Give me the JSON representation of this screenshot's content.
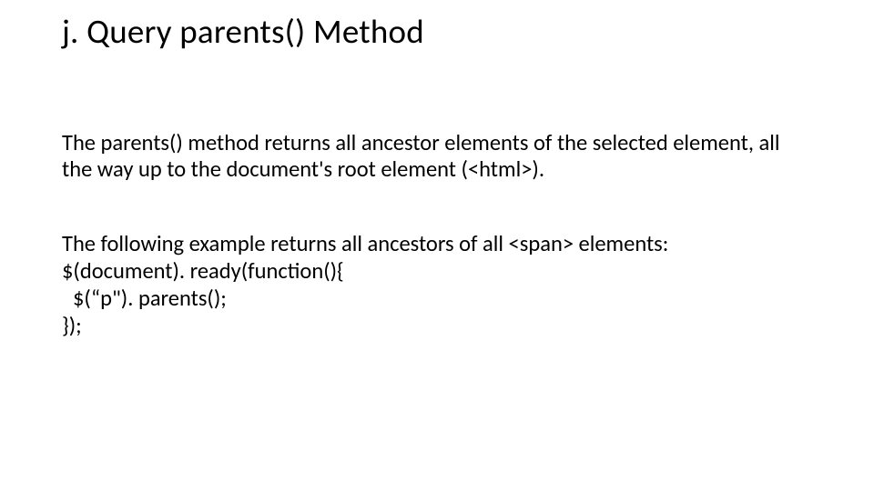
{
  "title": "j. Query parents() Method",
  "para1": "The parents() method returns all ancestor elements of the selected element, all the way up to the document's root element (<html>).",
  "para2_intro": "The following example returns all ancestors of all <span> elements:",
  "code": {
    "l1": "$(document). ready(function(){",
    "l2": "$(“p\"). parents();",
    "l3": "});"
  }
}
